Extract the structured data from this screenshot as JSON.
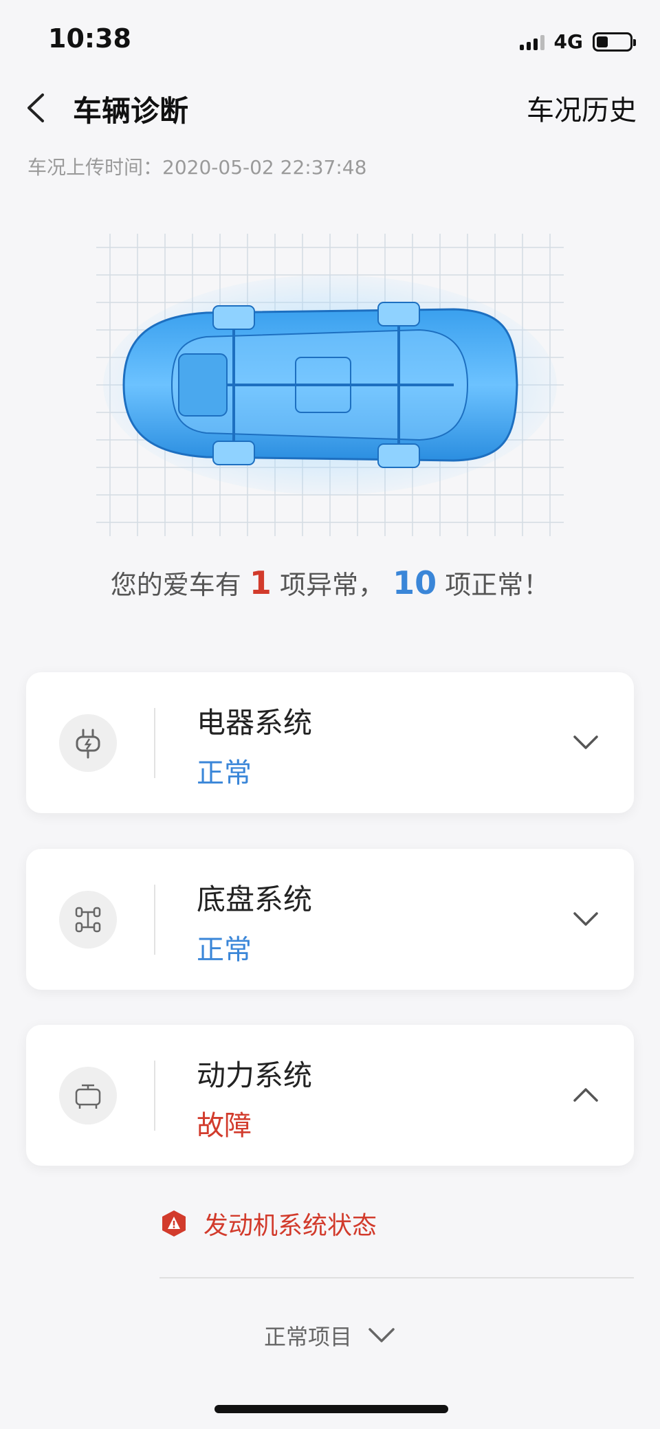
{
  "status_bar": {
    "time": "10:38",
    "network": "4G",
    "battery_level": 0.35
  },
  "nav": {
    "title": "车辆诊断",
    "history_label": "车况历史"
  },
  "upload": {
    "label": "车况上传时间：",
    "value": "2020-05-02 22:37:48"
  },
  "summary": {
    "prefix": "您的爱车有",
    "abnormal_count": "1",
    "middle": "项异常，",
    "normal_count": "10",
    "suffix": "项正常！"
  },
  "systems": [
    {
      "name": "电器系统",
      "status": "正常",
      "icon": "plug-icon",
      "expanded": false
    },
    {
      "name": "底盘系统",
      "status": "正常",
      "icon": "chassis-icon",
      "expanded": false
    },
    {
      "name": "动力系统",
      "status": "故障",
      "icon": "engine-icon",
      "expanded": true
    }
  ],
  "fault_items": [
    {
      "label": "发动机系统状态",
      "icon": "warning-icon"
    }
  ],
  "normal_items_toggle": {
    "label": "正常项目"
  },
  "colors": {
    "accent_blue": "#3a86d8",
    "fault_red": "#d23b2c",
    "background": "#f6f6f8"
  }
}
